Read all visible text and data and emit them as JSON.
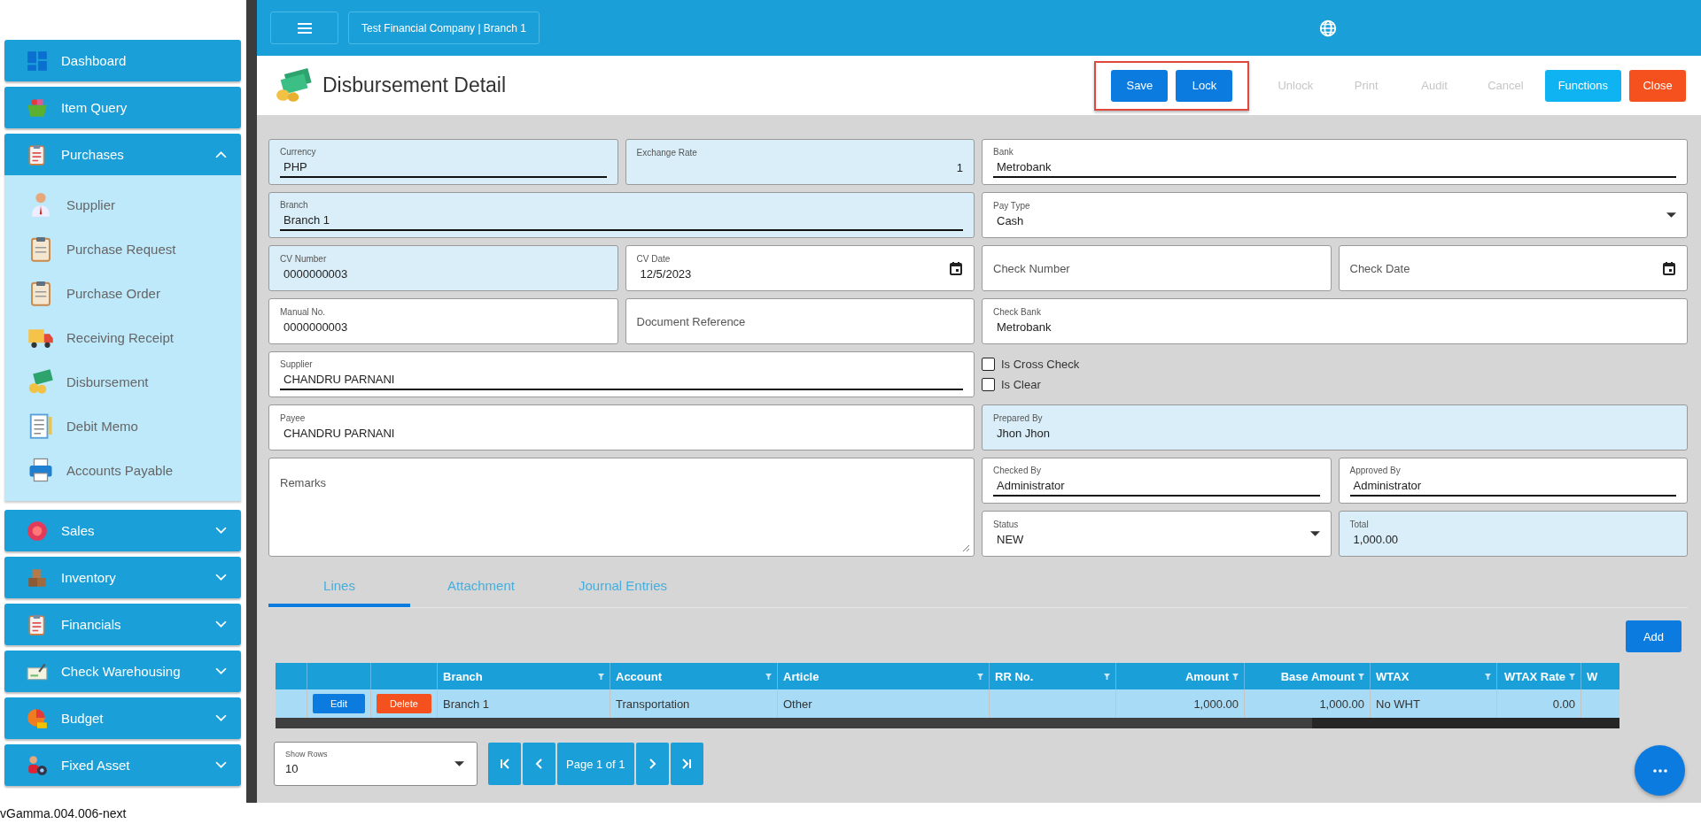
{
  "sidebar": {
    "items": [
      {
        "label": "Dashboard",
        "expanded": false,
        "expandable": false
      },
      {
        "label": "Item Query",
        "expanded": false,
        "expandable": false
      },
      {
        "label": "Purchases",
        "expanded": true,
        "expandable": true,
        "children": [
          {
            "label": "Supplier"
          },
          {
            "label": "Purchase Request"
          },
          {
            "label": "Purchase Order"
          },
          {
            "label": "Receiving Receipt"
          },
          {
            "label": "Disbursement"
          },
          {
            "label": "Debit Memo"
          },
          {
            "label": "Accounts Payable"
          }
        ]
      },
      {
        "label": "Sales",
        "expanded": false,
        "expandable": true
      },
      {
        "label": "Inventory",
        "expanded": false,
        "expandable": true
      },
      {
        "label": "Financials",
        "expanded": false,
        "expandable": true
      },
      {
        "label": "Check Warehousing",
        "expanded": false,
        "expandable": true
      },
      {
        "label": "Budget",
        "expanded": false,
        "expandable": true
      },
      {
        "label": "Fixed Asset",
        "expanded": false,
        "expandable": true
      }
    ]
  },
  "top_bar": {
    "company": "Test Financial Company | Branch 1"
  },
  "header": {
    "title": "Disbursement Detail",
    "button_groups": [
      {
        "highlighted": true,
        "buttons": [
          {
            "label": "Save",
            "kind": "primary",
            "disabled": false
          },
          {
            "label": "Lock",
            "kind": "primary",
            "disabled": false
          }
        ]
      },
      {
        "highlighted": false,
        "buttons": [
          {
            "label": "Unlock",
            "kind": "plain",
            "disabled": true
          },
          {
            "label": "Print",
            "kind": "plain",
            "disabled": true
          },
          {
            "label": "Audit",
            "kind": "plain",
            "disabled": true
          },
          {
            "label": "Cancel",
            "kind": "plain",
            "disabled": true
          },
          {
            "label": "Functions",
            "kind": "info",
            "disabled": false
          },
          {
            "label": "Close",
            "kind": "danger",
            "disabled": false
          }
        ]
      }
    ]
  },
  "form": {
    "fields": [
      {
        "kind": "text",
        "label": "Currency",
        "value": "PHP",
        "readonly": true,
        "underlined": true
      },
      {
        "kind": "number",
        "label": "Exchange Rate",
        "value": "1",
        "readonly": true,
        "underlined": false
      },
      {
        "kind": "text",
        "label": "Bank",
        "value": "Metrobank",
        "readonly": false,
        "underlined": true
      },
      {
        "kind": "text",
        "label": "Branch",
        "value": "Branch 1",
        "readonly": true,
        "underlined": true
      },
      {
        "kind": "select",
        "label": "Pay Type",
        "value": "Cash",
        "readonly": false,
        "underlined": false
      },
      {
        "kind": "text",
        "label": "CV Number",
        "value": "0000000003",
        "readonly": true,
        "underlined": false
      },
      {
        "kind": "date",
        "label": "CV Date",
        "value": "12/5/2023",
        "readonly": false,
        "underlined": false
      },
      {
        "kind": "text",
        "placeholder": "Check Number",
        "readonly": false,
        "underlined": false
      },
      {
        "kind": "date",
        "placeholder": "Check Date",
        "readonly": false,
        "underlined": false
      },
      {
        "kind": "text",
        "label": "Manual No.",
        "value": "0000000003",
        "readonly": false,
        "underlined": false
      },
      {
        "kind": "text",
        "placeholder": "Document Reference",
        "readonly": false,
        "underlined": false
      },
      {
        "kind": "text",
        "label": "Check Bank",
        "value": "Metrobank",
        "readonly": false,
        "underlined": false
      },
      {
        "kind": "text",
        "label": "Supplier",
        "value": "CHANDRU PARNANI",
        "readonly": false,
        "underlined": true
      },
      {
        "kind": "text",
        "label": "Payee",
        "value": "CHANDRU PARNANI",
        "readonly": false,
        "underlined": false
      },
      {
        "kind": "text",
        "label": "Prepared By",
        "value": "Jhon Jhon",
        "readonly": true,
        "underlined": false
      },
      {
        "kind": "textarea",
        "placeholder": "Remarks",
        "readonly": false,
        "underlined": false
      },
      {
        "kind": "text",
        "label": "Checked By",
        "value": "Administrator",
        "readonly": false,
        "underlined": true
      },
      {
        "kind": "text",
        "label": "Approved By",
        "value": "Administrator",
        "readonly": false,
        "underlined": true
      },
      {
        "kind": "select",
        "label": "Status",
        "value": "NEW",
        "readonly": false,
        "underlined": false
      },
      {
        "kind": "text",
        "label": "Total",
        "value": "1,000.00",
        "readonly": true,
        "underlined": false
      }
    ],
    "checkboxes": [
      {
        "label": "Is Cross Check",
        "checked": false
      },
      {
        "label": "Is Clear",
        "checked": false
      }
    ]
  },
  "tabs": [
    {
      "label": "Lines",
      "selected": true
    },
    {
      "label": "Attachment",
      "selected": false
    },
    {
      "label": "Journal Entries",
      "selected": false
    }
  ],
  "add_button": "Add",
  "table": {
    "columns": [
      {
        "kind": "row-header"
      },
      {
        "kind": "edit"
      },
      {
        "kind": "delete"
      },
      {
        "kind": "data",
        "label": "Branch",
        "filter": true,
        "numeric": false
      },
      {
        "kind": "data",
        "label": "Account",
        "filter": true,
        "numeric": false
      },
      {
        "kind": "data",
        "label": "Article",
        "filter": true,
        "numeric": false
      },
      {
        "kind": "data",
        "label": "RR No.",
        "filter": true,
        "numeric": false
      },
      {
        "kind": "data",
        "label": "Amount",
        "filter": true,
        "numeric": true
      },
      {
        "kind": "data",
        "label": "Base Amount",
        "filter": true,
        "numeric": true
      },
      {
        "kind": "data",
        "label": "WTAX",
        "filter": true,
        "numeric": false
      },
      {
        "kind": "data",
        "label": "WTAX Rate",
        "filter": true,
        "numeric": true
      },
      {
        "kind": "data",
        "label": "W",
        "numeric": false
      }
    ],
    "rows": [
      {
        "cells": [
          "",
          "Edit",
          "Delete",
          "Branch 1",
          "Transportation",
          "Other",
          "",
          "1,000.00",
          "1,000.00",
          "No WHT",
          "0.00",
          ""
        ]
      }
    ]
  },
  "pager": {
    "show_rows_label": "Show Rows",
    "show_rows_value": "10",
    "page": "Page 1 of 1"
  },
  "version": "vGamma.004.006-next"
}
